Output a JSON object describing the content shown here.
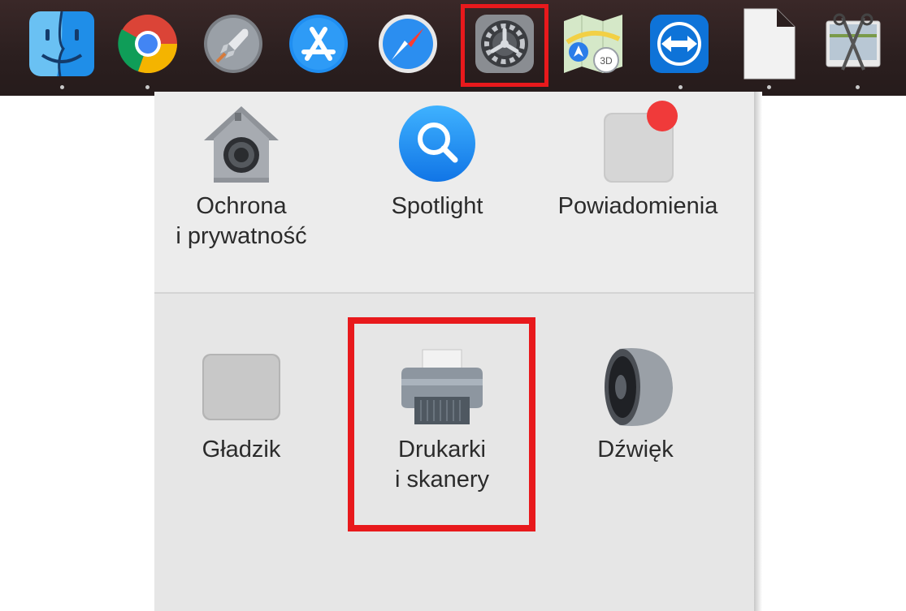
{
  "dock": {
    "apps": [
      {
        "name": "finder-icon",
        "label": "Finder"
      },
      {
        "name": "chrome-icon",
        "label": "Google Chrome"
      },
      {
        "name": "launchpad-icon",
        "label": "Launchpad"
      },
      {
        "name": "app-store-icon",
        "label": "App Store"
      },
      {
        "name": "safari-icon",
        "label": "Safari"
      },
      {
        "name": "system-preferences-icon",
        "label": "System Preferences"
      },
      {
        "name": "maps-icon",
        "label": "Maps"
      },
      {
        "name": "teamviewer-icon",
        "label": "TeamViewer"
      },
      {
        "name": "document-icon",
        "label": "Document"
      },
      {
        "name": "screenshot-tool-icon",
        "label": "Screenshot tool"
      }
    ],
    "highlighted_app": "System Preferences"
  },
  "preferences": {
    "row1": [
      {
        "id": "security",
        "label": "Ochrona\ni prywatność",
        "icon": "security-house-icon"
      },
      {
        "id": "spotlight",
        "label": "Spotlight",
        "icon": "spotlight-magnifier-icon"
      },
      {
        "id": "notifications",
        "label": "Powiadomienia",
        "icon": "notifications-icon"
      }
    ],
    "row2": [
      {
        "id": "trackpad",
        "label": "Gładzik",
        "icon": "trackpad-icon"
      },
      {
        "id": "printers",
        "label": "Drukarki\ni skanery",
        "icon": "printer-icon"
      },
      {
        "id": "sound",
        "label": "Dźwięk",
        "icon": "speaker-icon"
      }
    ],
    "highlighted": "printers"
  },
  "colors": {
    "highlight": "#e8191c",
    "panel": "#ececec",
    "dock": "#2b1f1f"
  }
}
